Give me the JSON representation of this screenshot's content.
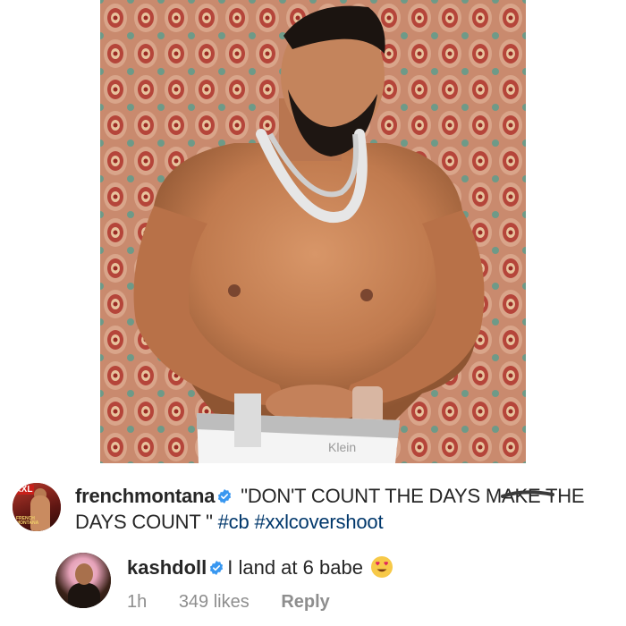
{
  "post": {
    "photo_belt_text": "Klein"
  },
  "caption": {
    "username": "frenchmontana",
    "text": " \"DON'T COUNT THE DAYS MAKE THE DAYS COUNT \" ",
    "hashtags": [
      "#cb",
      "#xxlcovershoot"
    ],
    "avatar_badge": "XXL",
    "avatar_small_text": "FRENCH MONTANA"
  },
  "comment": {
    "username": "kashdoll",
    "text": "I land at 6 babe",
    "emoji": "heart-eyes-emoji",
    "time": "1h",
    "likes": "349 likes",
    "reply_label": "Reply"
  },
  "colors": {
    "text": "#262626",
    "hashtag": "#00376b",
    "meta": "#8e8e8e",
    "verified": "#3897f0"
  }
}
